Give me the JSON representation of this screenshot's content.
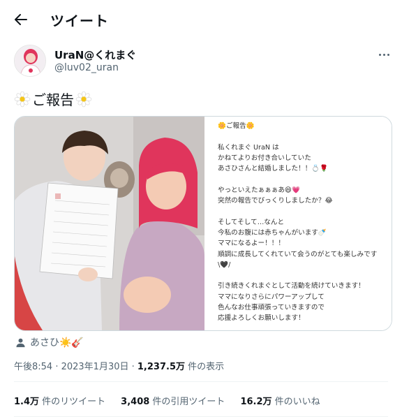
{
  "header": {
    "title": "ツイート"
  },
  "author": {
    "display_name": "UraN@くれまぐ",
    "handle": "@luv02_uran"
  },
  "tweet": {
    "text": "ご報告"
  },
  "notice": {
    "title": "ご報告",
    "lines": [
      "私くれまぐ UraN は",
      "かねてよりお付き合いしていた",
      "あさひさんと結婚しました！！💍🌹",
      "",
      "やっといえたぁぁぁあ😆💗",
      "突然の報告でびっくりしましたか？😂",
      "",
      "そしてそして…なんと",
      "今私のお腹には赤ちゃんがいます🍼",
      "ママになるよー！！！",
      "順調に成長してくれていて会うのがとても楽しみです",
      "\\🖤/",
      "",
      "引き続きくれまぐとして活動を続けていきます！",
      "ママになりさらにパワーアップして",
      "色んなお仕事頑張っていきますので",
      "応援よろしくお願いします！"
    ]
  },
  "tag": {
    "name": "あさひ☀️🎸"
  },
  "meta": {
    "time": "午後8:54 · 2023年1月30日 · ",
    "views": "1,237.5万",
    "views_label": " 件の表示"
  },
  "stats": {
    "retweets": "1.4万",
    "retweets_label": " 件のリツイート",
    "quotes": "3,408",
    "quotes_label": " 件の引用ツイート",
    "likes": "16.2万",
    "likes_label": " 件のいいね"
  },
  "colors": {
    "text": "#0f1419",
    "secondary": "#536471",
    "border": "#cfd9de",
    "hair": "#e0355c"
  }
}
